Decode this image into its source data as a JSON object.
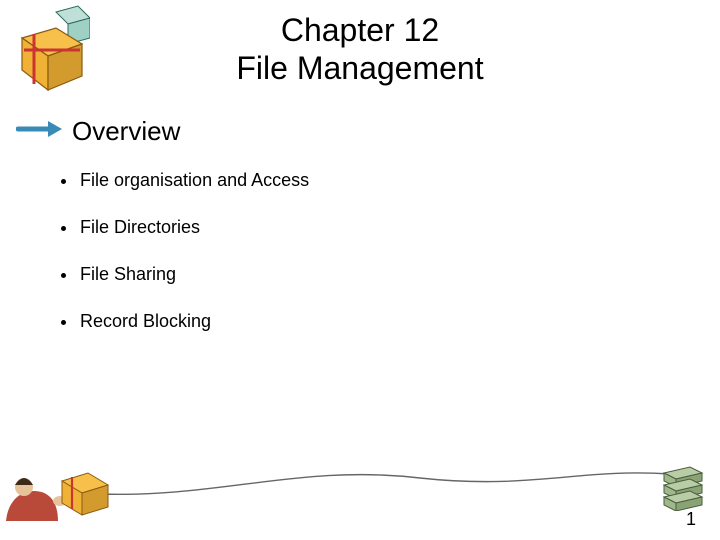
{
  "title": {
    "line1": "Chapter 12",
    "line2": "File Management"
  },
  "current_section": "Overview",
  "bullets": [
    "File organisation and Access",
    "File Directories",
    "File Sharing",
    "Record Blocking"
  ],
  "page_number": "1",
  "icons": {
    "top_left": "cube-package-icon",
    "arrow": "arrow-right-icon",
    "bottom_left": "person-carry-cube-icon",
    "bottom_right": "stacked-boxes-icon"
  },
  "colors": {
    "accent_arrow": "#3a8ab8",
    "cube_face": "#f6c04a",
    "cube_shadow": "#d39a2e",
    "stack_green": "#9fb88a",
    "stack_dark": "#6f8a5c"
  }
}
